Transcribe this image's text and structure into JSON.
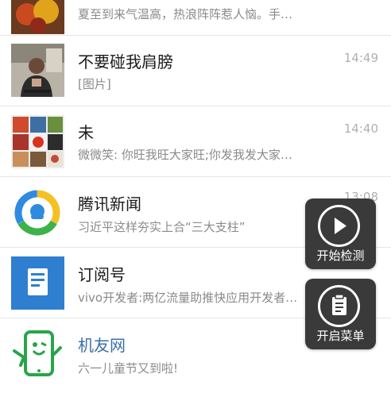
{
  "chats": [
    {
      "name": "",
      "preview": "夏至到来气温高，热浪阵阵惹人恼。手…",
      "time": "",
      "avatar": "flower-thumbnail-icon"
    },
    {
      "name": "不要碰我肩膀",
      "preview": "[图片]",
      "time": "14:49",
      "avatar": "person-photo-icon"
    },
    {
      "name": "未",
      "preview": "微微笑: 你旺我旺大家旺;你发我发大家…",
      "time": "14:40",
      "avatar": "group-grid-icon"
    },
    {
      "name": "腾讯新闻",
      "preview": "习近平这样夯实上合“三大支柱”",
      "time": "13:08",
      "avatar": "tencent-news-logo-icon"
    },
    {
      "name": "订阅号",
      "preview": "vivo开发者:两亿流量助推快应用开发者…",
      "time": "",
      "avatar": "subscription-doc-icon"
    },
    {
      "name": "机友网",
      "preview": "六一儿童节又到啦!",
      "time": "",
      "avatar": "jiyou-phone-logo-icon"
    }
  ],
  "floating": {
    "detect_label": "开始检测",
    "menu_label": "开启菜单"
  },
  "colors": {
    "name_highlight": "#3b6fa8",
    "fab_bg": "#3a3a3a",
    "subscription_blue": "#2f7fd0",
    "jiyou_green": "#2aa44a"
  }
}
